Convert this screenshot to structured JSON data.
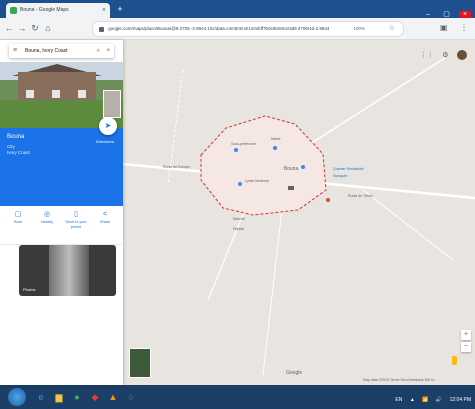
{
  "browser": {
    "tab_title": "Bouna - Google Maps",
    "tab_close": "×",
    "new_tab": "+",
    "window_controls": [
      "–",
      "▢",
      "×"
    ],
    "nav": {
      "back": "←",
      "forward": "→",
      "reload": "↻",
      "home": "⌂"
    },
    "url": "google.com/maps/place/Bouna/@9.2706,-2.9944,15z/data=!4m5!3m4!1s0xfdf7b0c5b!8m2!3d9.2706!4d-2.9944",
    "zoom": "100%",
    "extra_icons": [
      "⋮"
    ]
  },
  "panel": {
    "search_query": "Bouna, Ivory Coast",
    "place_name": "Bouna",
    "place_meta": [
      "City",
      "Ivory Coast"
    ],
    "directions_label": "Directions",
    "actions": [
      {
        "icon": "▢",
        "label": "Save"
      },
      {
        "icon": "◎",
        "label": "Nearby"
      },
      {
        "icon": "▯",
        "label": "Send to your phone"
      },
      {
        "icon": "<",
        "label": "Share"
      }
    ],
    "photo_label": "Photos"
  },
  "map": {
    "labels": [
      "Bouna",
      "Sous-préfecture",
      "Mairie",
      "Lycée Moderne",
      "Marché",
      "Hôpital",
      "Route de Doropo",
      "Route de Téhini",
      "Quartier Résidentiel",
      "Mosquée"
    ],
    "logo": "Google",
    "attribution": "Map data ©2019  Terms  Send feedback  500 m",
    "boundary_color": "#d93025",
    "road_color": "#ffffff"
  },
  "taskbar": {
    "icons": [
      {
        "glyph": "e",
        "color": "#3a8fd8"
      },
      {
        "glyph": "▆",
        "color": "#f4c542"
      },
      {
        "glyph": "●",
        "color": "#4caf50"
      },
      {
        "glyph": "◆",
        "color": "#e53935"
      },
      {
        "glyph": "▲",
        "color": "#ff9800"
      },
      {
        "glyph": "○",
        "color": "#34a853"
      }
    ],
    "tray": [
      "EN",
      "▲",
      "📶",
      "🔊",
      "12:04 PM"
    ]
  }
}
